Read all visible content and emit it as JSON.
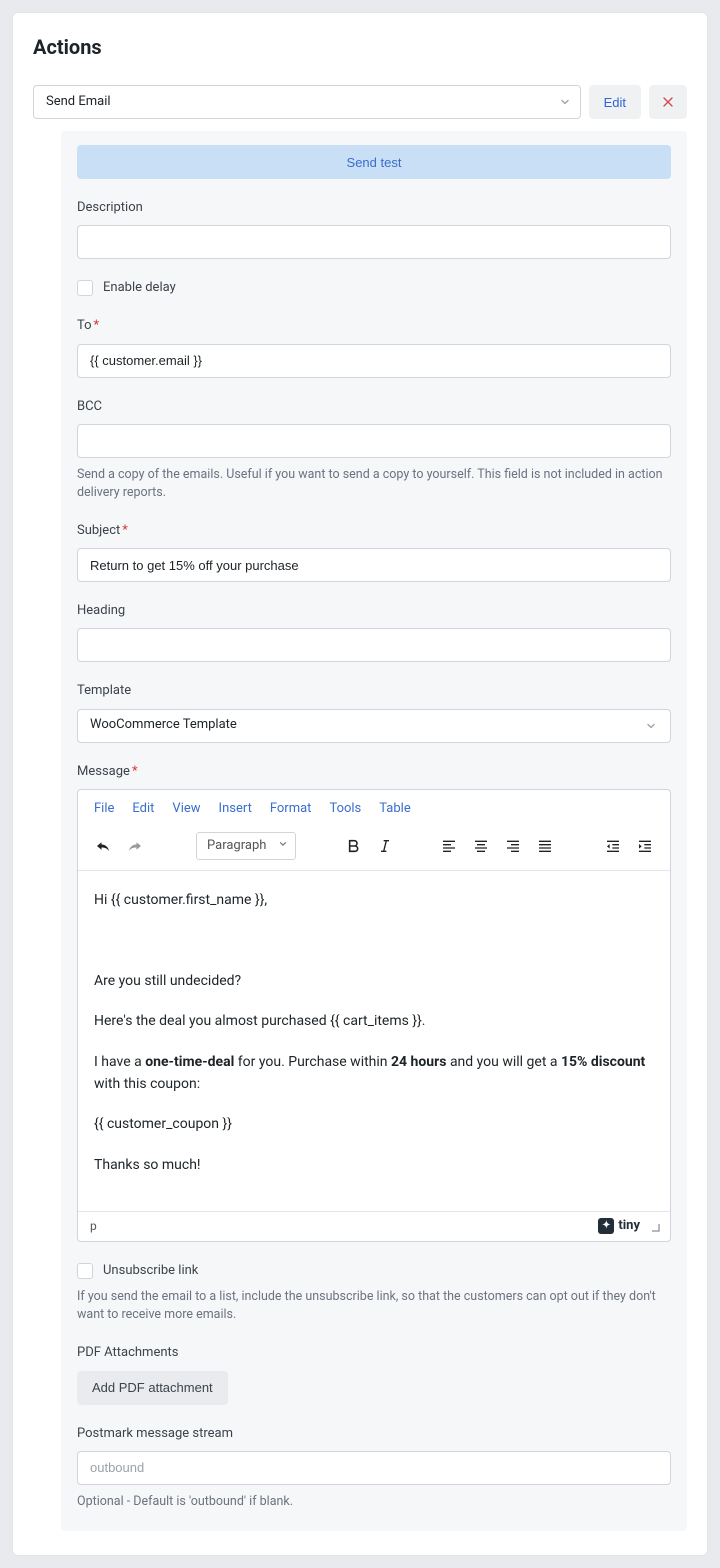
{
  "title": "Actions",
  "topRow": {
    "selectedAction": "Send Email",
    "editLabel": "Edit"
  },
  "sendTestLabel": "Send test",
  "description": {
    "label": "Description",
    "value": ""
  },
  "enableDelay": {
    "label": "Enable delay",
    "checked": false
  },
  "to": {
    "label": "To",
    "required": true,
    "value": "{{ customer.email }}"
  },
  "bcc": {
    "label": "BCC",
    "value": "",
    "help": "Send a copy of the emails. Useful if you want to send a copy to yourself. This field is not included in action delivery reports."
  },
  "subject": {
    "label": "Subject",
    "required": true,
    "value": "Return to get 15% off your purchase"
  },
  "heading": {
    "label": "Heading",
    "value": ""
  },
  "template": {
    "label": "Template",
    "value": "WooCommerce Template"
  },
  "message": {
    "label": "Message",
    "required": true,
    "menu": [
      "File",
      "Edit",
      "View",
      "Insert",
      "Format",
      "Tools",
      "Table"
    ],
    "paragraphLabel": "Paragraph",
    "bodyParts": {
      "p1": "Hi {{ customer.first_name }},",
      "p2": "Are you still undecided?",
      "p3": "Here's the deal you almost purchased {{ cart_items }}.",
      "p4_a": "I have a ",
      "p4_b": "one-time-deal",
      "p4_c": " for you. Purchase within ",
      "p4_d": "24 hours",
      "p4_e": " and you will get a ",
      "p4_f": "15% discount",
      "p4_g": " with this coupon:",
      "p5": "{{ customer_coupon }}",
      "p6": "Thanks so much!"
    },
    "statusPath": "p",
    "tinyLabel": "tiny"
  },
  "unsubscribe": {
    "label": "Unsubscribe link",
    "checked": false,
    "help": "If you send the email to a list, include the unsubscribe link, so that the customers can opt out if they don't want to receive more emails."
  },
  "pdf": {
    "label": "PDF Attachments",
    "buttonLabel": "Add PDF attachment"
  },
  "postmark": {
    "label": "Postmark message stream",
    "placeholder": "outbound",
    "value": "",
    "help": "Optional - Default is 'outbound' if blank."
  }
}
